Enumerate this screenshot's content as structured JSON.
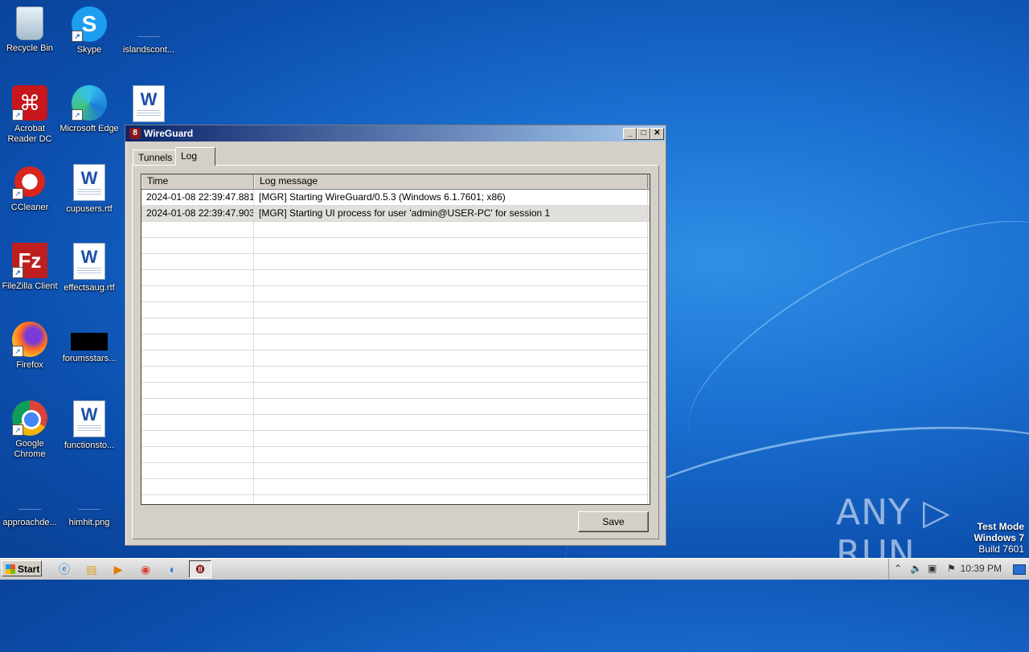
{
  "desktop": {
    "icons": [
      {
        "label": "Recycle Bin"
      },
      {
        "label": "Skype"
      },
      {
        "label": "islandscont..."
      },
      {
        "label": "Acrobat Reader DC"
      },
      {
        "label": "Microsoft Edge"
      },
      {
        "label": ""
      },
      {
        "label": "CCleaner"
      },
      {
        "label": "cupusers.rtf"
      },
      {
        "label": "FileZilla Client"
      },
      {
        "label": "effectsaug.rtf"
      },
      {
        "label": "Firefox"
      },
      {
        "label": "forumsstars..."
      },
      {
        "label": "Google Chrome"
      },
      {
        "label": "functionsto..."
      },
      {
        "label": "approachde..."
      },
      {
        "label": "himhit.png"
      }
    ]
  },
  "window": {
    "title": "WireGuard",
    "app_icon_glyph": "8",
    "controls": {
      "minimize": "_",
      "maximize": "□",
      "close": "✕"
    },
    "tabs": [
      {
        "label": "Tunnels",
        "active": false
      },
      {
        "label": "Log",
        "active": true
      }
    ],
    "log": {
      "columns": [
        "Time",
        "Log message"
      ],
      "rows": [
        {
          "time": "2024-01-08 22:39:47.881",
          "message": "[MGR] Starting WireGuard/0.5.3 (Windows 6.1.7601; x86)"
        },
        {
          "time": "2024-01-08 22:39:47.903",
          "message": "[MGR] Starting UI process for user 'admin@USER-PC' for session 1"
        }
      ]
    },
    "save_label": "Save"
  },
  "watermark": {
    "text": "ANY ▷ RUN"
  },
  "os_mode": {
    "line1": "Test Mode",
    "line2": "Windows 7",
    "line3": "Build 7601"
  },
  "taskbar": {
    "start_label": "Start",
    "clock": "10:39 PM"
  },
  "colors": {
    "titlebar_start": "#0a246a",
    "titlebar_end": "#a6caf0",
    "window_face": "#d4d0c8",
    "selected_row": "#e1dfdb"
  }
}
